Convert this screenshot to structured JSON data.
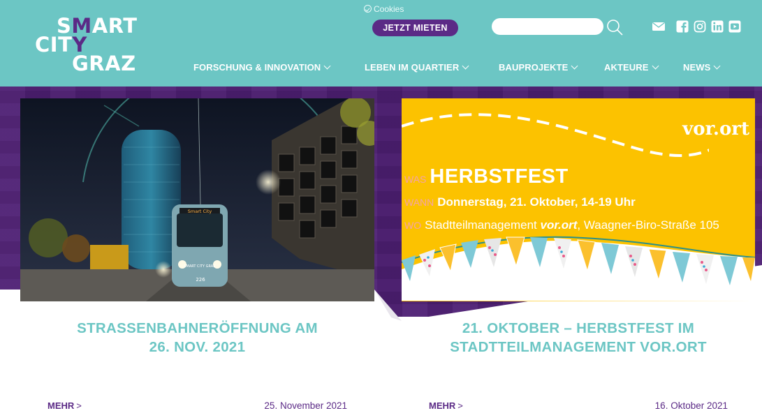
{
  "header": {
    "logo": {
      "line1_s": "S",
      "line1_m": "M",
      "line1_rest": "ART",
      "line2_cit": "CIT",
      "line2_y": "Y",
      "line3": "GRAZ"
    },
    "cookies_label": "Cookies",
    "cta_label": "JETZT MIETEN",
    "search_placeholder": "",
    "nav": [
      {
        "label": "FORSCHUNG & INNOVATION"
      },
      {
        "label": "LEBEN IM QUARTIER"
      },
      {
        "label": "BAUPROJEKTE"
      },
      {
        "label": "AKTEURE"
      },
      {
        "label": "NEWS"
      }
    ],
    "social_icons": [
      "mail-icon",
      "facebook-icon",
      "instagram-icon",
      "linkedin-icon",
      "youtube-icon"
    ]
  },
  "colors": {
    "teal": "#6cc6c4",
    "purple": "#5b2a86",
    "yellow": "#fcc200"
  },
  "posts": [
    {
      "title_line1": "STRASSENBAHNERÖFFNUNG AM",
      "title_line2": "26. NOV. 2021",
      "more_label": "MEHR",
      "more_arrow": ">",
      "date": "25. November 2021",
      "image": {
        "tram_display": "Smart City",
        "tram_number": "226",
        "tram_side": "SMART CITY GRAZ"
      }
    },
    {
      "title_line1": "21. OKTOBER – HERBSTFEST IM",
      "title_line2": "STADTTEILMANAGEMENT VOR.ORT",
      "more_label": "MEHR",
      "more_arrow": ">",
      "date": "16. Oktober 2021",
      "image": {
        "logo_vor": "vor.",
        "logo_ort": "ort",
        "was_key": "WAS",
        "was_value": "HERBSTFEST",
        "wann_key": "WANN",
        "wann_value": "Donnerstag, 21. Oktober, 14-19 Uhr",
        "wo_key": "WO",
        "wo_value_a": "Stadtteilmanagement ",
        "wo_value_b": "vor.ort",
        "wo_value_c": ", Waagner-Biro-Straße 105"
      }
    }
  ]
}
